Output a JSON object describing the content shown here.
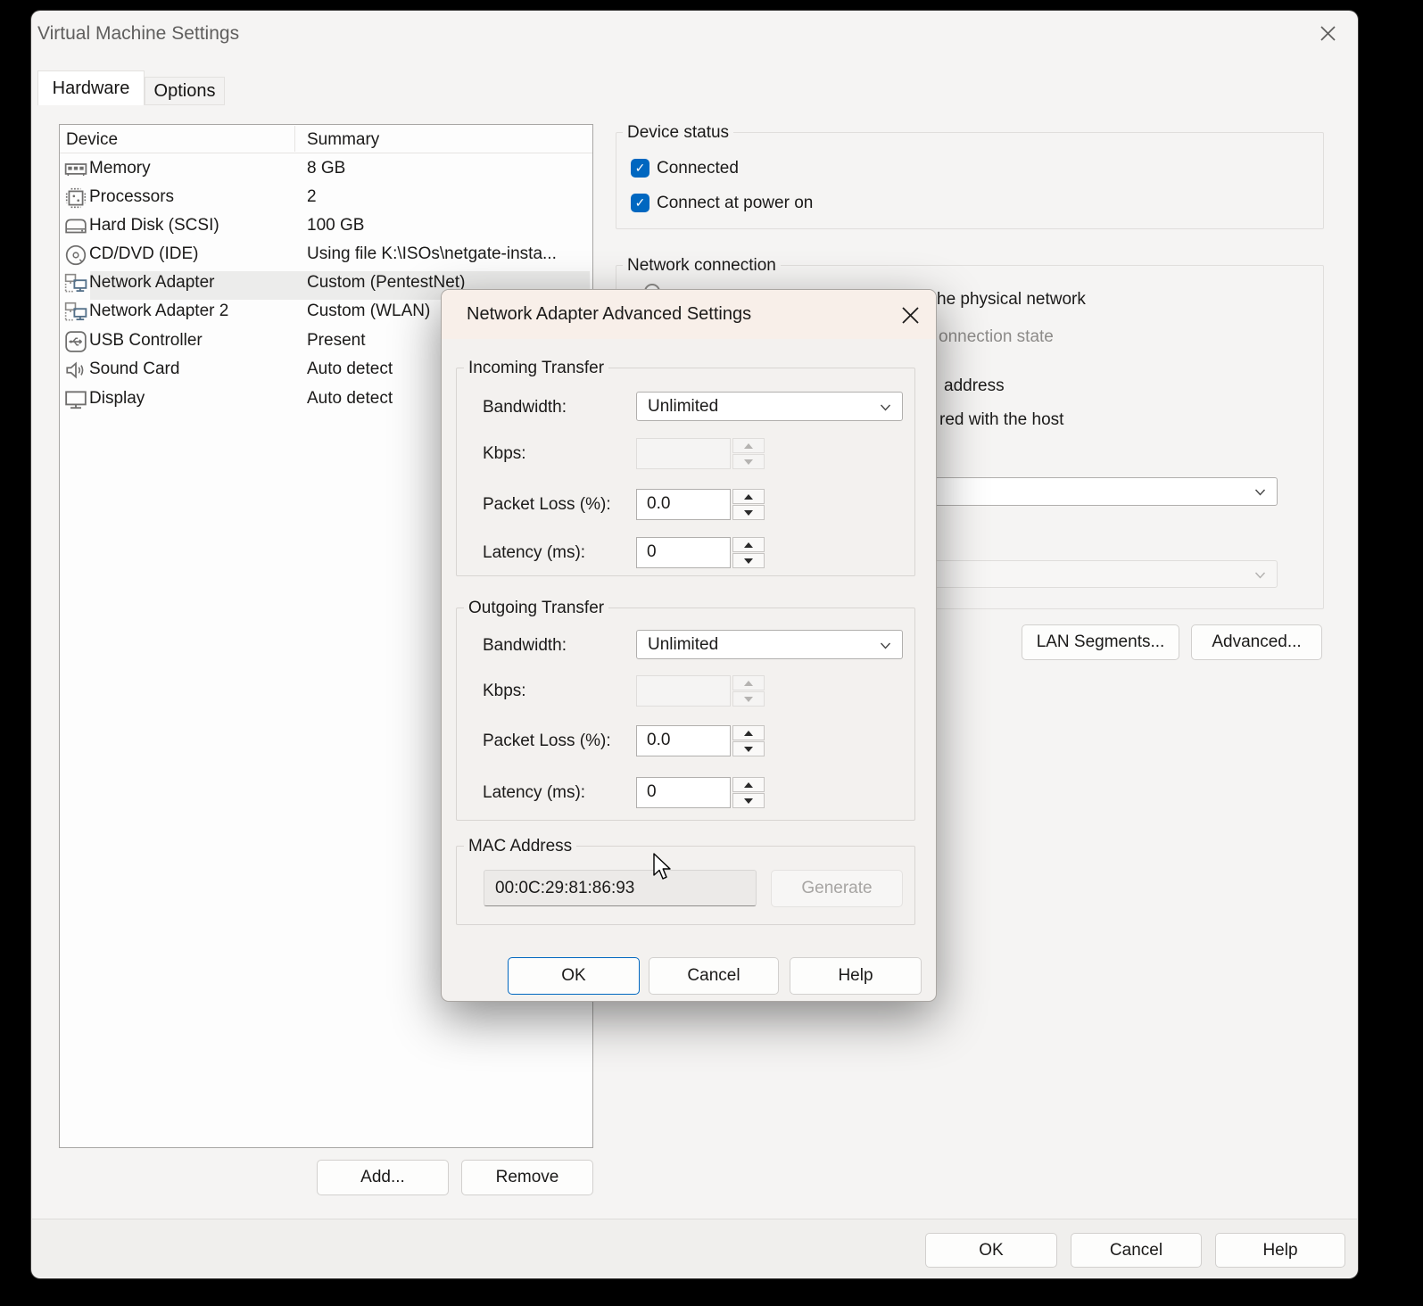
{
  "window": {
    "title": "Virtual Machine Settings"
  },
  "tabs": [
    {
      "label": "Hardware"
    },
    {
      "label": "Options"
    }
  ],
  "device_table": {
    "columns": [
      "Device",
      "Summary"
    ],
    "rows": [
      {
        "device": "Memory",
        "summary": "8 GB",
        "icon": "memory-icon"
      },
      {
        "device": "Processors",
        "summary": "2",
        "icon": "processor-icon"
      },
      {
        "device": "Hard Disk (SCSI)",
        "summary": "100 GB",
        "icon": "hard-disk-icon"
      },
      {
        "device": "CD/DVD (IDE)",
        "summary": "Using file K:\\ISOs\\netgate-insta...",
        "icon": "cd-dvd-icon"
      },
      {
        "device": "Network Adapter",
        "summary": "Custom (PentestNet)",
        "icon": "network-adapter-icon"
      },
      {
        "device": "Network Adapter 2",
        "summary": "Custom (WLAN)",
        "icon": "network-adapter-icon"
      },
      {
        "device": "USB Controller",
        "summary": "Present",
        "icon": "usb-icon"
      },
      {
        "device": "Sound Card",
        "summary": "Auto detect",
        "icon": "sound-icon"
      },
      {
        "device": "Display",
        "summary": "Auto detect",
        "icon": "display-icon"
      }
    ],
    "add_label": "Add...",
    "remove_label": "Remove"
  },
  "device_status": {
    "title": "Device status",
    "checkboxes": [
      {
        "label": "Connected",
        "checked": true
      },
      {
        "label": "Connect at power on",
        "checked": true
      }
    ],
    "check_glyph": "✓"
  },
  "network_connection": {
    "title": "Network connection",
    "visible_fragments": [
      {
        "text": "he physical network",
        "muted": false
      },
      {
        "text": "onnection state",
        "muted": true
      },
      {
        "text": "address",
        "muted": false
      },
      {
        "text": "red with the host",
        "muted": false
      }
    ],
    "lan_segments_label": "LAN Segments...",
    "advanced_label": "Advanced..."
  },
  "modal": {
    "title": "Network Adapter Advanced Settings",
    "incoming": {
      "title": "Incoming Transfer",
      "bandwidth_label": "Bandwidth:",
      "bandwidth_value": "Unlimited",
      "kbps_label": "Kbps:",
      "kbps_value": "",
      "packet_loss_label": "Packet Loss (%):",
      "packet_loss_value": "0.0",
      "latency_label": "Latency (ms):",
      "latency_value": "0"
    },
    "outgoing": {
      "title": "Outgoing Transfer",
      "bandwidth_label": "Bandwidth:",
      "bandwidth_value": "Unlimited",
      "kbps_label": "Kbps:",
      "kbps_value": "",
      "packet_loss_label": "Packet Loss (%):",
      "packet_loss_value": "0.0",
      "latency_label": "Latency (ms):",
      "latency_value": "0"
    },
    "mac": {
      "title": "MAC Address",
      "value": "00:0C:29:81:86:93",
      "generate_label": "Generate"
    },
    "buttons": {
      "ok": "OK",
      "cancel": "Cancel",
      "help": "Help"
    }
  },
  "footer_buttons": {
    "ok": "OK",
    "cancel": "Cancel",
    "help": "Help"
  },
  "colors": {
    "accent": "#0067c0",
    "modal_header": "#f8efe9",
    "selection": "#ececeb"
  }
}
